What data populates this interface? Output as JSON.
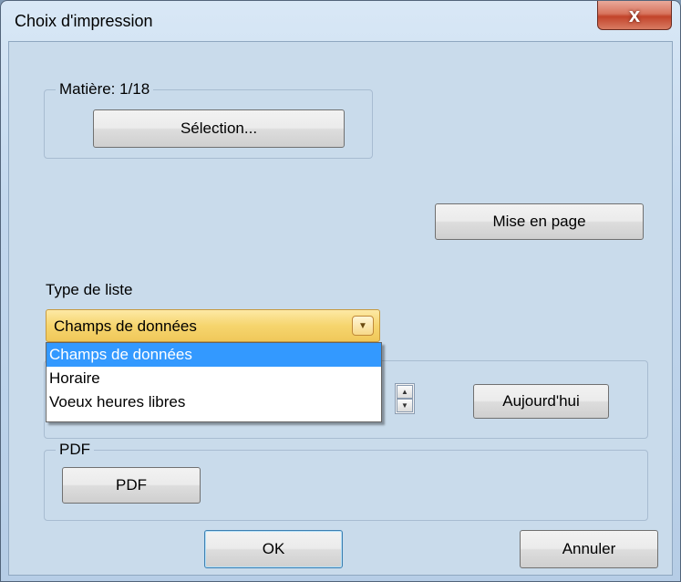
{
  "window": {
    "title": "Choix d'impression",
    "close_glyph": "x"
  },
  "subject_group": {
    "legend": "Matière: 1/18",
    "selection_button": "Sélection..."
  },
  "layout_button": "Mise en page",
  "list_type": {
    "label": "Type de liste",
    "selected": "Champs de données",
    "options": [
      "Champs de données",
      "Horaire",
      "Voeux heures libres"
    ]
  },
  "date_group": {
    "today_button": "Aujourd'hui"
  },
  "pdf_group": {
    "legend": "PDF",
    "pdf_button": "PDF"
  },
  "footer": {
    "ok_button": "OK",
    "cancel_button": "Annuler"
  },
  "icons": {
    "close": "close-icon",
    "dropdown_arrow": "chevron-down-icon",
    "spin_up": "spin-up-icon",
    "spin_down": "spin-down-icon"
  },
  "colors": {
    "selected_item": "#3399ff",
    "combo_highlight": "#f6d56e",
    "close_button": "#c2432a"
  }
}
